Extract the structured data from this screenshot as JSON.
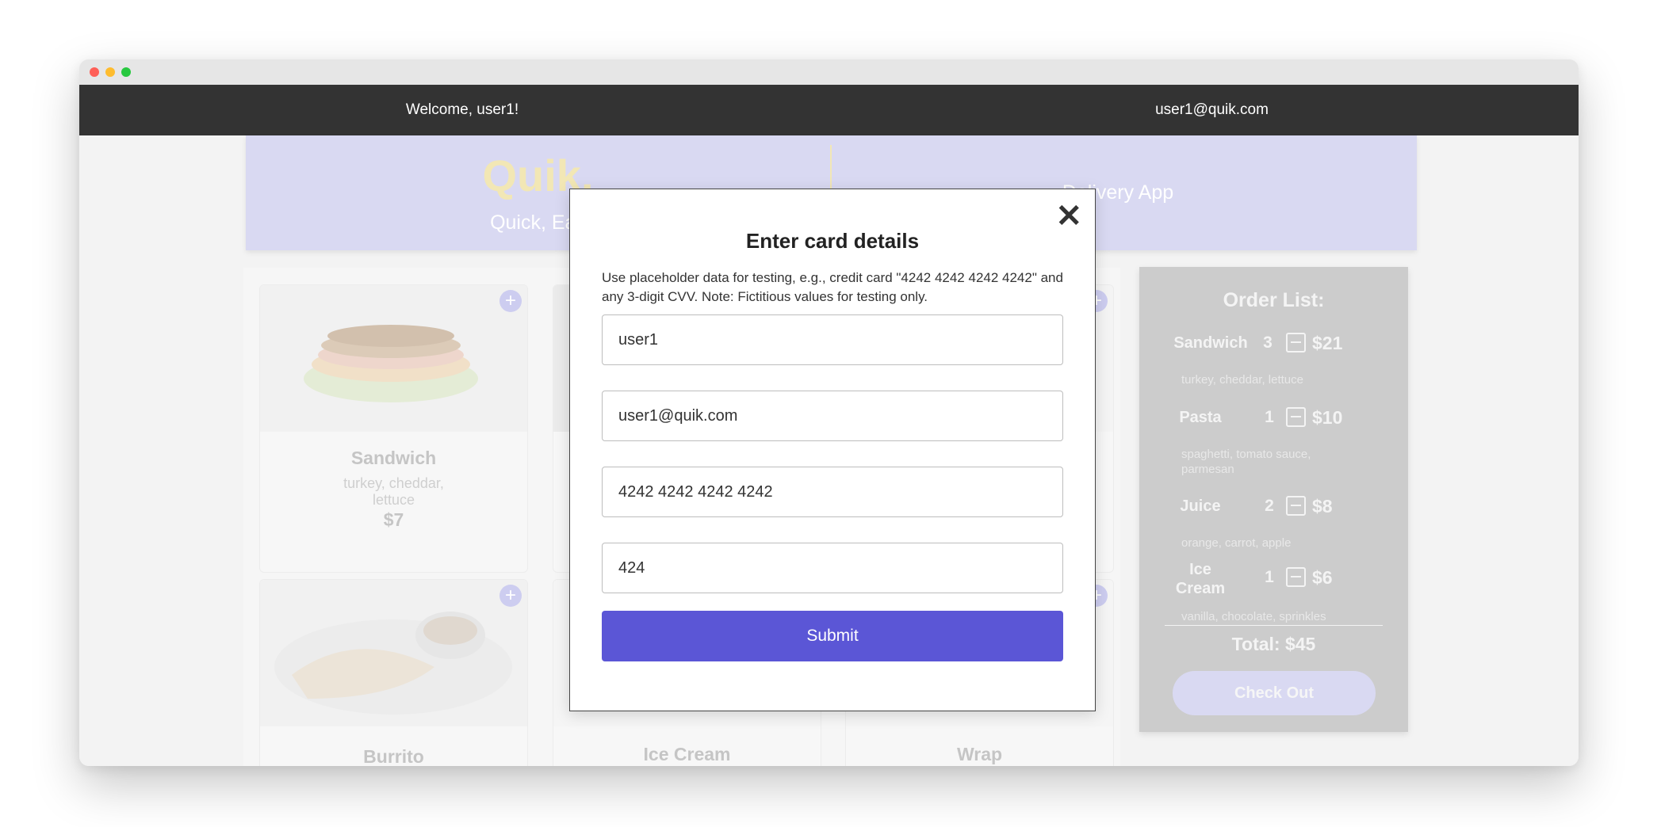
{
  "topbar": {
    "welcome": "Welcome, user1!",
    "email": "user1@quik.com"
  },
  "hero": {
    "logo": "Quik.",
    "tagline_left": "Quick, Eas",
    "tagline_right": "Delivery App"
  },
  "menu": {
    "items": [
      {
        "name": "Sandwich",
        "description": "turkey, cheddar, lettuce",
        "price": "$7"
      },
      {
        "name": "Burrito"
      },
      {
        "name": "Ice Cream"
      },
      {
        "name": "Wrap"
      }
    ],
    "add_icon": "plus-icon"
  },
  "order": {
    "heading": "Order List:",
    "items": [
      {
        "name": "Sandwich",
        "qty": "3",
        "total": "$21",
        "ingredients": "turkey, cheddar, lettuce"
      },
      {
        "name": "Pasta",
        "qty": "1",
        "total": "$10",
        "ingredients": "spaghetti, tomato sauce, parmesan"
      },
      {
        "name": "Juice",
        "qty": "2",
        "total": "$8",
        "ingredients": "orange, carrot, apple"
      },
      {
        "name": "Ice Cream",
        "qty": "1",
        "total": "$6",
        "ingredients": "vanilla, chocolate, sprinkles"
      }
    ],
    "grand_total": "Total: $45",
    "checkout_label": "Check Out"
  },
  "modal": {
    "title": "Enter card details",
    "note": "Use placeholder data for testing, e.g., credit card \"4242 4242 4242 4242\" and any 3-digit CVV. Note: Fictitious values for testing only.",
    "fields": {
      "name": "user1",
      "email": "user1@quik.com",
      "card": "4242 4242 4242 4242",
      "cvv": "424"
    },
    "submit_label": "Submit",
    "close_icon": "close-icon"
  },
  "colors": {
    "accent": "#5b56d6",
    "hero_bg": "#d9d9f2",
    "logo": "#f2e7b5",
    "topbar": "#333333"
  }
}
